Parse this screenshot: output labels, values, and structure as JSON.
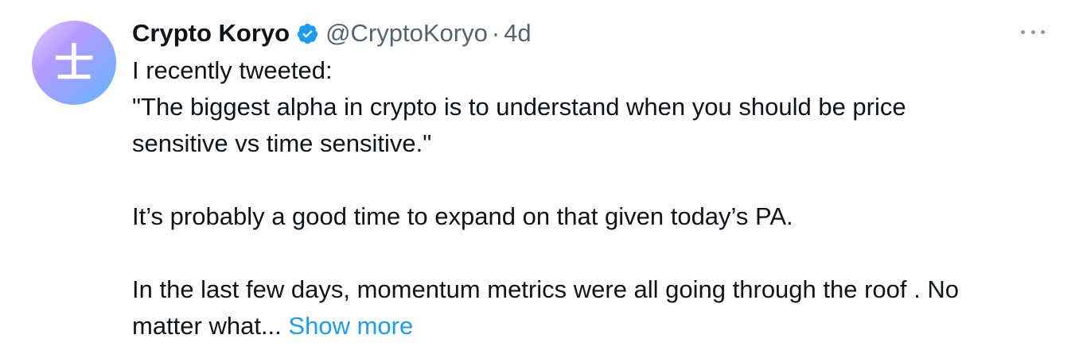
{
  "tweet": {
    "avatar_glyph": "士",
    "display_name": "Crypto Koryo",
    "verified_icon": "verified-badge-icon",
    "handle": "@CryptoKoryo",
    "separator": "·",
    "time": "4d",
    "lines": {
      "l1": "I recently tweeted:",
      "l2": "\"The biggest alpha in crypto is to understand when you should be price",
      "l3": "sensitive vs time sensitive.\"",
      "l4": "It’s probably a good time to expand on that given today’s PA.",
      "l5": "In the last few days, momentum metrics were all going through the roof . No",
      "l6": "matter what..."
    },
    "show_more": "Show more",
    "more_icon": "more-options-icon"
  },
  "colors": {
    "text": "#0f1419",
    "secondary": "#536471",
    "accent": "#1d9bf0"
  }
}
